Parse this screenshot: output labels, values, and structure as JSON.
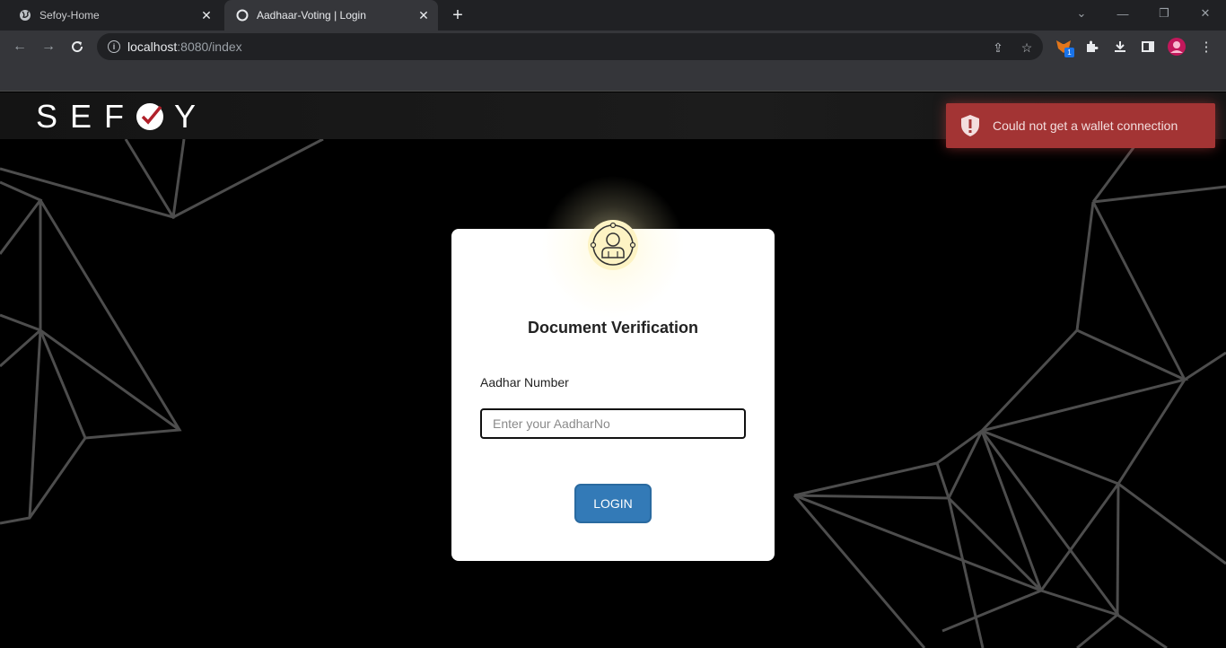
{
  "browser": {
    "tabs": [
      {
        "title": "Sefoy-Home",
        "active": false
      },
      {
        "title": "Aadhaar-Voting | Login",
        "active": true
      }
    ],
    "url_host": "localhost",
    "url_path": ":8080/index",
    "extension_badge": "1"
  },
  "header": {
    "logo_left": "SEF",
    "logo_right": "Y"
  },
  "toast": {
    "message": "Could not get a wallet connection",
    "color": "#a33434"
  },
  "login": {
    "title": "Document Verification",
    "aadhar_label": "Aadhar Number",
    "aadhar_placeholder": "Enter your AadharNo",
    "aadhar_value": "",
    "login_button": "LOGIN",
    "button_color": "#337ab7"
  }
}
